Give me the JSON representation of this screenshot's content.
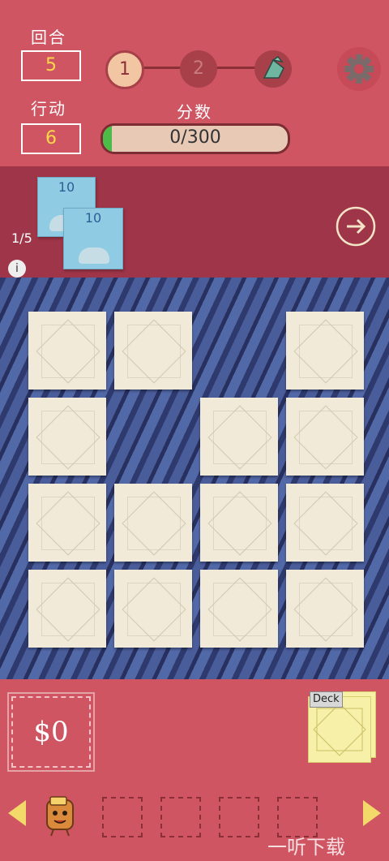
{
  "header": {
    "turn_label": "回合",
    "turn_value": "5",
    "action_label": "行动",
    "action_value": "6",
    "score_label": "分数",
    "score_text": "0/300",
    "score_fraction": 0.0,
    "stages": [
      "1",
      "2",
      ""
    ]
  },
  "hand": {
    "counter": "1/5",
    "info": "i",
    "cards": [
      {
        "value": "10"
      },
      {
        "value": "10"
      }
    ]
  },
  "bottom": {
    "money": "$0",
    "deck_label": "Deck"
  },
  "watermark": "一听下载",
  "colors": {
    "background": "#cf5563",
    "hand_band": "#9e3548",
    "accent_yellow": "#ffd84a",
    "score_green": "#4dbb47",
    "board_blue": "#4a5d9b",
    "tile": "#f1ead8"
  }
}
